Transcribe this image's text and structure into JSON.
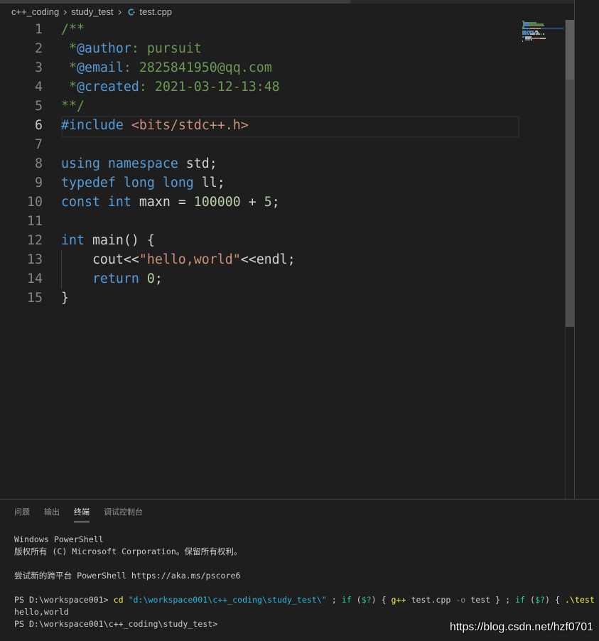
{
  "breadcrumb": {
    "folder_1": "c++_coding",
    "folder_2": "study_test",
    "file": "test.cpp",
    "separator_icon": "chevron-right-icon",
    "file_icon": "cpp-file-icon",
    "file_icon_color": "#519ABA"
  },
  "editor": {
    "active_line": 6,
    "lines": [
      {
        "number": 1,
        "tokens": [
          {
            "text": "/**",
            "type": "comment"
          }
        ]
      },
      {
        "number": 2,
        "tokens": [
          {
            "text": " *",
            "type": "comment"
          },
          {
            "text": "@author",
            "type": "doctag"
          },
          {
            "text": ": pursuit",
            "type": "comment"
          }
        ]
      },
      {
        "number": 3,
        "tokens": [
          {
            "text": " *",
            "type": "comment"
          },
          {
            "text": "@email",
            "type": "doctag"
          },
          {
            "text": ": 2825841950@qq.com",
            "type": "comment"
          }
        ]
      },
      {
        "number": 4,
        "tokens": [
          {
            "text": " *",
            "type": "comment"
          },
          {
            "text": "@created",
            "type": "doctag"
          },
          {
            "text": ": 2021-03-12-13:48",
            "type": "comment"
          }
        ]
      },
      {
        "number": 5,
        "tokens": [
          {
            "text": "**/",
            "type": "comment"
          }
        ]
      },
      {
        "number": 6,
        "tokens": [
          {
            "text": "#include",
            "type": "keyword"
          },
          {
            "text": " <bits/stdc++.h>",
            "type": "string"
          }
        ]
      },
      {
        "number": 7,
        "tokens": []
      },
      {
        "number": 8,
        "tokens": [
          {
            "text": "using",
            "type": "keyword"
          },
          {
            "text": " namespace",
            "type": "keyword"
          },
          {
            "text": " std;",
            "type": "plain"
          }
        ]
      },
      {
        "number": 9,
        "tokens": [
          {
            "text": "typedef",
            "type": "keyword"
          },
          {
            "text": " long",
            "type": "keyword"
          },
          {
            "text": " long",
            "type": "keyword"
          },
          {
            "text": " ll;",
            "type": "plain"
          }
        ]
      },
      {
        "number": 10,
        "tokens": [
          {
            "text": "const",
            "type": "keyword"
          },
          {
            "text": " int",
            "type": "keyword"
          },
          {
            "text": " maxn = ",
            "type": "plain"
          },
          {
            "text": "100000",
            "type": "number"
          },
          {
            "text": " + ",
            "type": "plain"
          },
          {
            "text": "5",
            "type": "number"
          },
          {
            "text": ";",
            "type": "plain"
          }
        ]
      },
      {
        "number": 11,
        "tokens": []
      },
      {
        "number": 12,
        "tokens": [
          {
            "text": "int",
            "type": "keyword"
          },
          {
            "text": " main() {",
            "type": "plain"
          }
        ]
      },
      {
        "number": 13,
        "tokens": [
          {
            "text": "    cout<<",
            "type": "plain"
          },
          {
            "text": "\"hello,world\"",
            "type": "string"
          },
          {
            "text": "<<endl;",
            "type": "plain"
          }
        ]
      },
      {
        "number": 14,
        "tokens": [
          {
            "text": "    return",
            "type": "keyword"
          },
          {
            "text": " 0",
            "type": "number"
          },
          {
            "text": ";",
            "type": "plain"
          }
        ]
      },
      {
        "number": 15,
        "tokens": [
          {
            "text": "}",
            "type": "plain"
          }
        ]
      }
    ]
  },
  "panel": {
    "tabs": [
      {
        "label": "问题",
        "active": false
      },
      {
        "label": "输出",
        "active": false
      },
      {
        "label": "终端",
        "active": true
      },
      {
        "label": "调试控制台",
        "active": false
      }
    ]
  },
  "terminal": {
    "lines": [
      [
        {
          "text": "Windows PowerShell",
          "type": "default"
        }
      ],
      [
        {
          "text": "版权所有 (C) Microsoft Corporation。保留所有权利。",
          "type": "default"
        }
      ],
      [],
      [
        {
          "text": "尝试新的跨平台 PowerShell https://aka.ms/pscore6",
          "type": "default"
        }
      ],
      [],
      [
        {
          "text": "PS D:\\workspace001> ",
          "type": "default"
        },
        {
          "text": "cd",
          "type": "command"
        },
        {
          "text": " \"d:\\workspace001\\c++_coding\\study_test\\\"",
          "type": "string"
        },
        {
          "text": " ; ",
          "type": "default"
        },
        {
          "text": "if",
          "type": "keyword"
        },
        {
          "text": " (",
          "type": "default"
        },
        {
          "text": "$?",
          "type": "variable"
        },
        {
          "text": ") { ",
          "type": "default"
        },
        {
          "text": "g++",
          "type": "command"
        },
        {
          "text": " test.cpp ",
          "type": "default"
        },
        {
          "text": "-o",
          "type": "parameter"
        },
        {
          "text": " test } ; ",
          "type": "default"
        },
        {
          "text": "if",
          "type": "keyword"
        },
        {
          "text": " (",
          "type": "default"
        },
        {
          "text": "$?",
          "type": "variable"
        },
        {
          "text": ") { ",
          "type": "default"
        },
        {
          "text": ".\\test",
          "type": "command"
        }
      ],
      [
        {
          "text": "hello,world",
          "type": "default"
        }
      ],
      [
        {
          "text": "PS D:\\workspace001\\c++_coding\\study_test>",
          "type": "default"
        }
      ]
    ]
  },
  "watermark": "https://blog.csdn.net/hzf0701",
  "colors": {
    "syntax": {
      "comment": "#6A9955",
      "doctag": "#569CD6",
      "keyword": "#569CD6",
      "string": "#CE9178",
      "number": "#B5CEA8",
      "plain": "#D4D4D4"
    },
    "terminal": {
      "default": "#CCCCCC",
      "command": "#F5F543",
      "string": "#29B8DB",
      "keyword": "#23D18B",
      "variable": "#23D18B",
      "parameter": "#8A8A8A"
    }
  }
}
